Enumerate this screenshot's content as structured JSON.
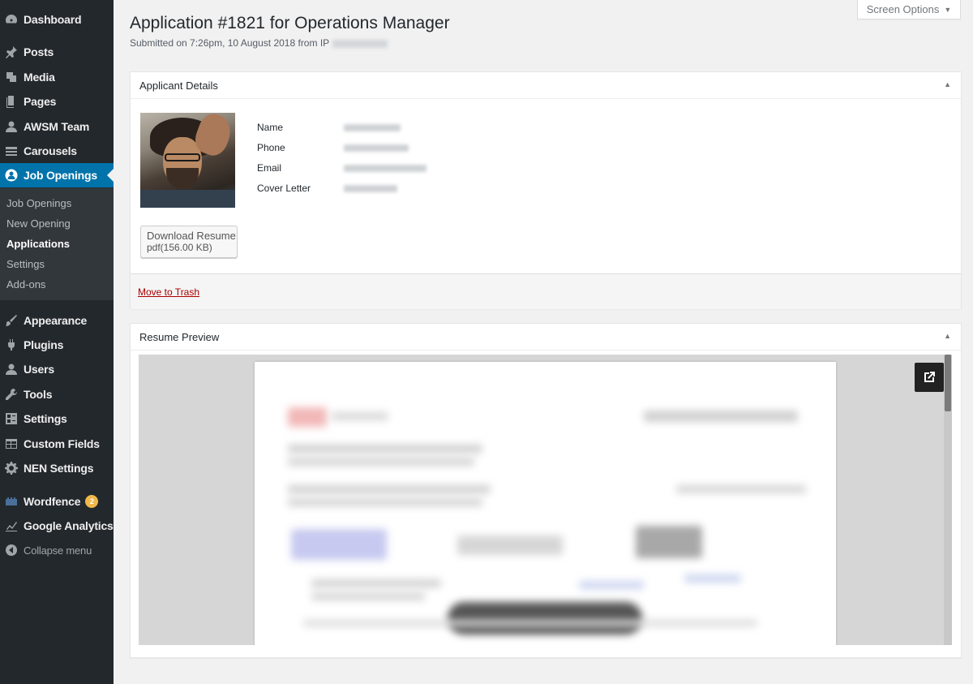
{
  "sidebar": {
    "items": [
      {
        "label": "Dashboard",
        "icon": "dashboard-icon"
      },
      {
        "label": "Posts",
        "icon": "pin-icon"
      },
      {
        "label": "Media",
        "icon": "media-icon"
      },
      {
        "label": "Pages",
        "icon": "pages-icon"
      },
      {
        "label": "AWSM Team",
        "icon": "user-icon"
      },
      {
        "label": "Carousels",
        "icon": "carousel-icon"
      },
      {
        "label": "Job Openings",
        "icon": "job-icon"
      },
      {
        "label": "Appearance",
        "icon": "brush-icon"
      },
      {
        "label": "Plugins",
        "icon": "plug-icon"
      },
      {
        "label": "Users",
        "icon": "users-icon"
      },
      {
        "label": "Tools",
        "icon": "wrench-icon"
      },
      {
        "label": "Settings",
        "icon": "settings-icon"
      },
      {
        "label": "Custom Fields",
        "icon": "fields-icon"
      },
      {
        "label": "NEN Settings",
        "icon": "gear-icon"
      },
      {
        "label": "Wordfence",
        "icon": "wordfence-icon",
        "badge": "2"
      },
      {
        "label": "Google Analytics",
        "icon": "chart-icon"
      },
      {
        "label": "Collapse menu",
        "icon": "collapse-icon"
      }
    ],
    "submenu": [
      "Job Openings",
      "New Opening",
      "Applications",
      "Settings",
      "Add-ons"
    ]
  },
  "header": {
    "screen_options": "Screen Options",
    "title": "Application #1821 for Operations Manager",
    "subtitle": "Submitted on 7:26pm, 10 August 2018 from IP"
  },
  "applicant": {
    "heading": "Applicant Details",
    "fields": [
      "Name",
      "Phone",
      "Email",
      "Cover Letter"
    ],
    "download_label": "Download Resume",
    "download_meta": "pdf(156.00 KB)",
    "trash_label": "Move to Trash"
  },
  "preview": {
    "heading": "Resume Preview"
  },
  "colors": {
    "sidebar": "#23282d",
    "accent": "#0073aa",
    "badge": "#f0b849",
    "trash": "#aa0000"
  }
}
